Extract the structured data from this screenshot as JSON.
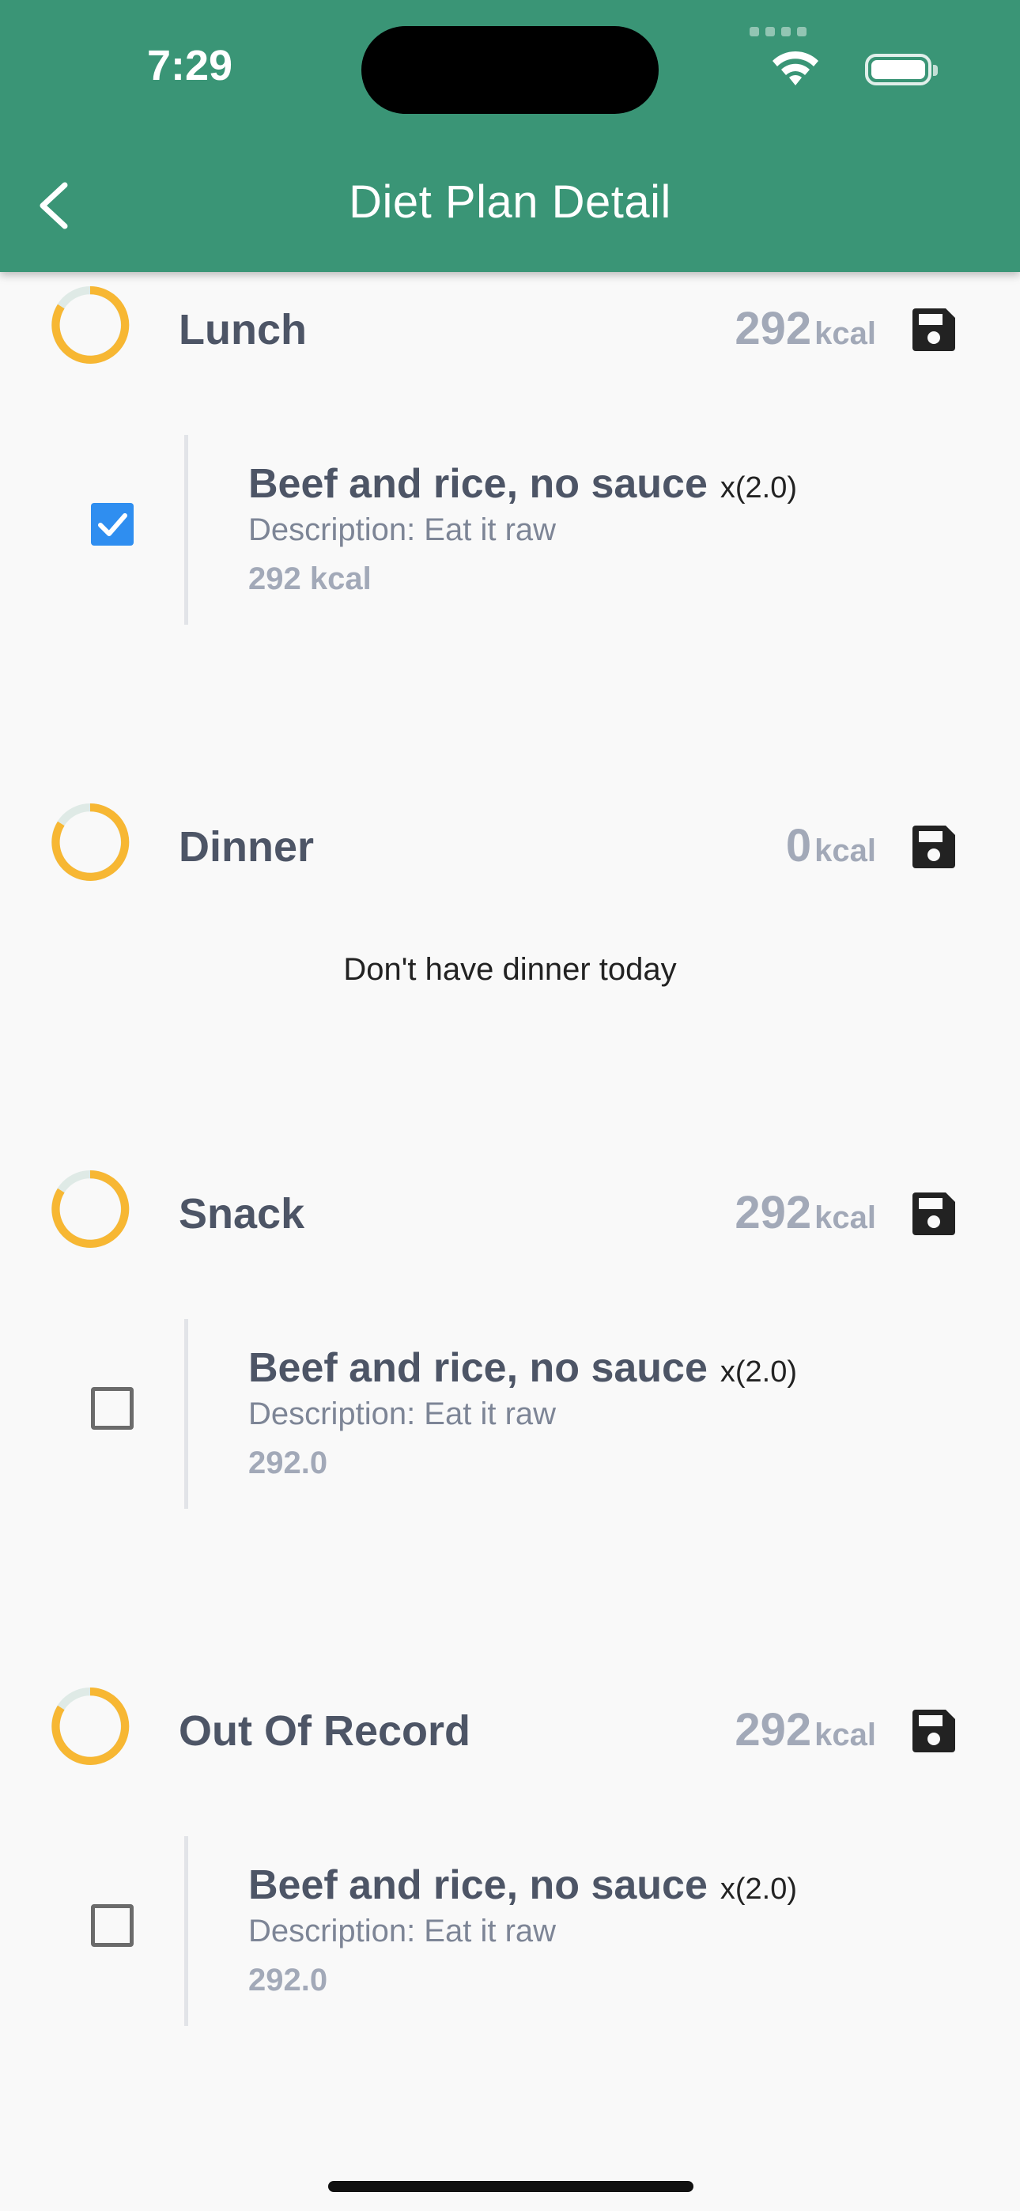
{
  "status_bar": {
    "time": "7:29"
  },
  "header": {
    "title": "Diet Plan Detail",
    "back_icon": "chevron-left-icon"
  },
  "colors": {
    "header_bg": "#3a9576",
    "ring_accent": "#f7b733",
    "ring_track": "#dfeae6",
    "checkbox_checked": "#2f8ef0"
  },
  "meals": [
    {
      "name": "Lunch",
      "kcal": "292",
      "kcal_unit": "kcal",
      "items": [
        {
          "name": "Beef and rice, no sauce",
          "qty": "x(2.0)",
          "desc": "Description: Eat it raw",
          "kcal": "292 kcal",
          "checked": true
        }
      ]
    },
    {
      "name": "Dinner",
      "kcal": "0",
      "kcal_unit": "kcal",
      "empty_message": "Don't have dinner today",
      "items": []
    },
    {
      "name": "Snack",
      "kcal": "292",
      "kcal_unit": "kcal",
      "items": [
        {
          "name": "Beef and rice, no sauce",
          "qty": "x(2.0)",
          "desc": "Description: Eat it raw",
          "kcal": "292.0",
          "checked": false
        }
      ]
    },
    {
      "name": "Out Of Record",
      "kcal": "292",
      "kcal_unit": "kcal",
      "items": [
        {
          "name": "Beef and rice, no sauce",
          "qty": "x(2.0)",
          "desc": "Description: Eat it raw",
          "kcal": "292.0",
          "checked": false
        }
      ]
    }
  ]
}
